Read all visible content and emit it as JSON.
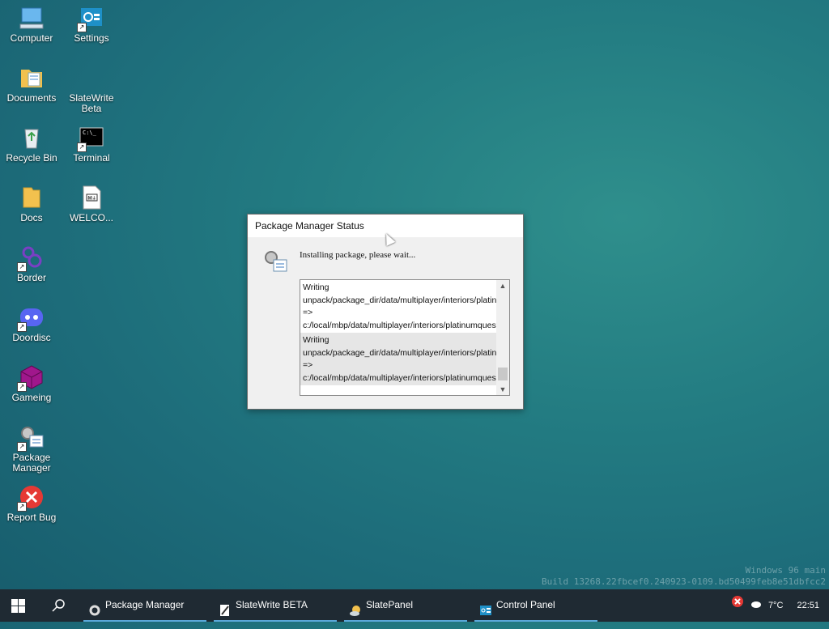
{
  "desktop": {
    "icons": [
      {
        "label": "Computer"
      },
      {
        "label": "Settings"
      },
      {
        "label": "Documents"
      },
      {
        "label": "SlateWrite Beta"
      },
      {
        "label": "Recycle Bin"
      },
      {
        "label": "Terminal"
      },
      {
        "label": "Docs"
      },
      {
        "label": "WELCO..."
      },
      {
        "label": "Border"
      },
      {
        "label": "Doordisc"
      },
      {
        "label": "Gameing"
      },
      {
        "label": "Package Manager"
      },
      {
        "label": "Report Bug"
      }
    ],
    "watermark_line1": "Windows 96 main",
    "watermark_line2": "Build 13268.22fbcef0.240923-0109.bd50499feb8e51dbfcc2"
  },
  "dialog": {
    "title": "Package Manager Status",
    "message": "Installing package, please wait...",
    "log_lines": [
      "Writing unpack/package_dir/data/multiplayer/interiors/platinumquest/pq_ray_wall_combo.png => c:/local/mbp/data/multiplayer/interiors/platinumquest/pq_ray_wall_combo.png",
      "Writing unpack/package_dir/data/multiplayer/interiors/platinumquest/pq_ray_wall_combo.spec.png => c:/local/mbp/data/multiplayer/interiors/platinumquest/pq_ray_wall_combo.spec.png"
    ]
  },
  "taskbar": {
    "tasks": [
      {
        "label": "Package Manager",
        "icon": "gear-icon"
      },
      {
        "label": "SlateWrite BETA",
        "icon": "pen-icon"
      },
      {
        "label": "SlatePanel",
        "icon": "weather-icon"
      },
      {
        "label": "Control Panel",
        "icon": "control-panel-icon"
      }
    ],
    "temperature": "7°C",
    "time": "22:51"
  },
  "colors": {
    "taskbar": "#1f2a33",
    "accent": "#5aa7d8",
    "desktop": "#237c82",
    "error": "#e53935"
  }
}
